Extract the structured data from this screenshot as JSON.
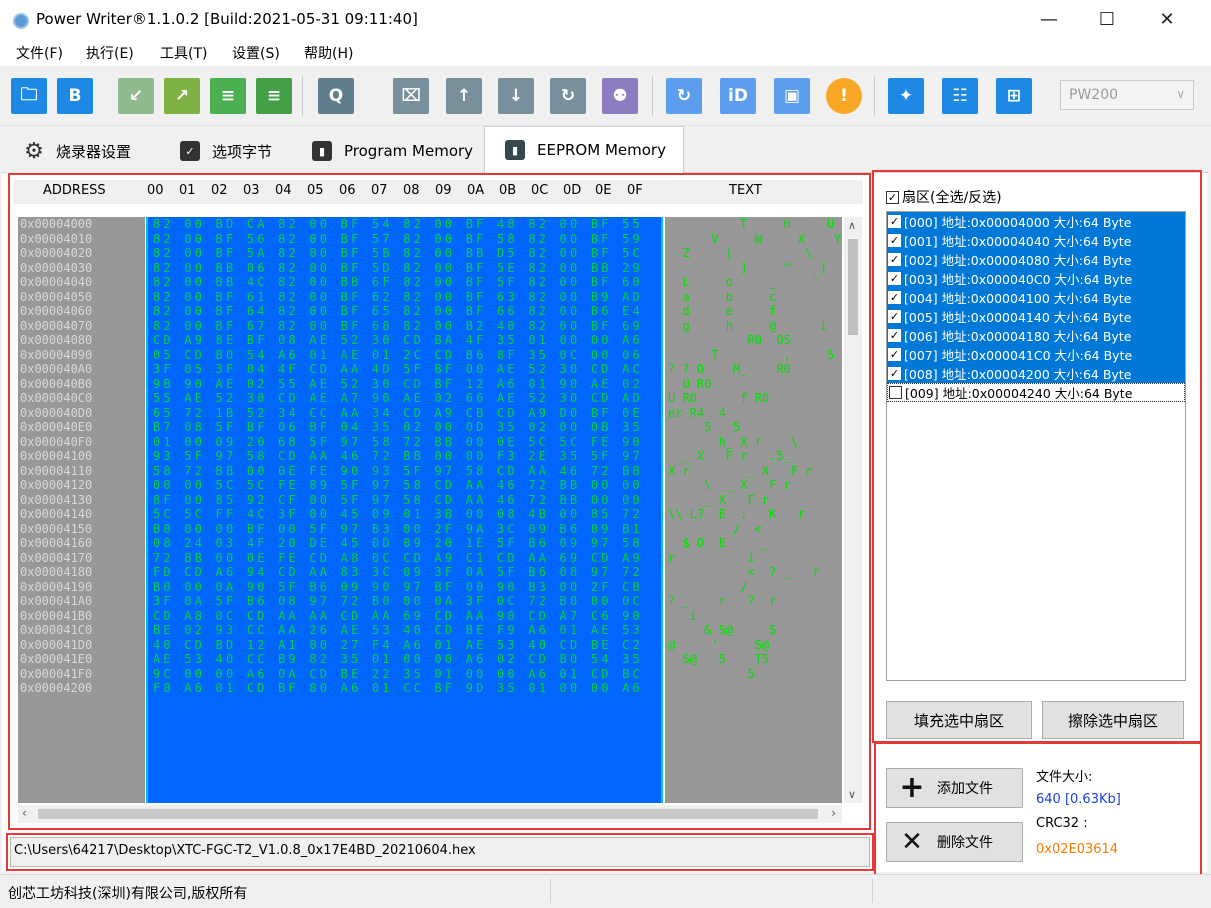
{
  "window": {
    "title": "Power Writer®1.1.0.2 [Build:2021-05-31 09:11:40]",
    "minimize_glyph": "—",
    "maximize_glyph": "☐",
    "close_glyph": "✕"
  },
  "menu": [
    "文件(F)",
    "执行(E)",
    "工具(T)",
    "设置(S)",
    "帮助(H)"
  ],
  "toolbar": {
    "buttons": [
      {
        "icon": "open-folder-icon",
        "color": "#1e88e5"
      },
      {
        "icon": "save-icon",
        "color": "#1e88e5"
      },
      {
        "icon": "import-icon",
        "color": "#8fbc8f"
      },
      {
        "icon": "export-icon",
        "color": "#7cb342"
      },
      {
        "icon": "chip-load-icon",
        "color": "#4caf50"
      },
      {
        "icon": "chip-save-icon",
        "color": "#43a047"
      },
      {
        "icon": "search-icon",
        "color": "#607d8b"
      },
      {
        "icon": "erase-chip-icon",
        "color": "#78909c"
      },
      {
        "icon": "program-chip-icon",
        "color": "#78909c"
      },
      {
        "icon": "verify-chip-icon",
        "color": "#78909c"
      },
      {
        "icon": "read-chip-icon",
        "color": "#78909c"
      },
      {
        "icon": "auto-program-icon",
        "color": "#8e7cc3"
      },
      {
        "icon": "refresh-icon",
        "color": "#5c9ded"
      },
      {
        "icon": "id-icon",
        "color": "#5c9ded"
      },
      {
        "icon": "stop-icon",
        "color": "#5c9ded"
      },
      {
        "icon": "warning-icon",
        "color": "#f9a825"
      },
      {
        "icon": "tool-icon",
        "color": "#1e88e5"
      },
      {
        "icon": "config-icon",
        "color": "#1e88e5"
      },
      {
        "icon": "layout-icon",
        "color": "#1e88e5"
      }
    ],
    "device_select": "PW200"
  },
  "tabs": [
    {
      "label": "烧录器设置",
      "icon": "gear-icon"
    },
    {
      "label": "选项字节",
      "icon": "option-icon"
    },
    {
      "label": "Program Memory",
      "icon": "memory-icon"
    },
    {
      "label": "EEPROM Memory",
      "icon": "memory-icon"
    }
  ],
  "hex": {
    "col_address": "ADDRESS",
    "columns": [
      "00",
      "01",
      "02",
      "03",
      "04",
      "05",
      "06",
      "07",
      "08",
      "09",
      "0A",
      "0B",
      "0C",
      "0D",
      "0E",
      "0F"
    ],
    "col_text": "TEXT",
    "addresses": [
      "0x00004000",
      "0x00004010",
      "0x00004020",
      "0x00004030",
      "0x00004040",
      "0x00004050",
      "0x00004060",
      "0x00004070",
      "0x00004080",
      "0x00004090",
      "0x000040A0",
      "0x000040B0",
      "0x000040C0",
      "0x000040D0",
      "0x000040E0",
      "0x000040F0",
      "0x00004100",
      "0x00004110",
      "0x00004120",
      "0x00004130",
      "0x00004140",
      "0x00004150",
      "0x00004160",
      "0x00004170",
      "0x00004180",
      "0x00004190",
      "0x000041A0",
      "0x000041B0",
      "0x000041C0",
      "0x000041D0",
      "0x000041E0",
      "0x000041F0",
      "0x00004200"
    ],
    "rows": [
      "82 00 BD CA 82 00 BF 54 82 00 BF 48 82 00 BF 55",
      "82 00 BF 56 82 00 BF 57 82 00 BF 58 82 00 BF 59",
      "82 00 BF 5A 82 00 BF 5B 82 00 BB D5 82 00 BF 5C",
      "82 00 BB 06 82 00 BF 5D 82 00 BF 5E 82 00 BB 29",
      "82 00 BB 4C 82 00 BB 6F 82 00 BF 5F 82 00 BF 60",
      "82 00 BF 61 82 00 BF 62 82 00 BF 63 82 00 B9 AD",
      "82 00 BF 64 82 00 BF 65 82 00 BF 66 82 00 B6 E4",
      "82 00 BF 67 82 00 BF 68 82 00 B2 40 82 00 BF 69",
      "CD A9 8E BF 08 AE 52 30 CD BA 4F 35 01 00 00 A6",
      "05 CD B0 54 A6 01 AE 01 2C CD B6 8F 35 0C 00 06",
      "3F 05 3F 04 4F CD AA 4D 5F BF 00 AE 52 30 CD AC",
      "9B 90 AE 02 55 AE 52 30 CD BF 12 A6 01 90 AE 02",
      "55 AE 52 30 CD AE A7 90 AE 02 66 AE 52 30 CD AD",
      "65 72 1B 52 34 CC AA 34 CD A9 CB CD A9 D0 BF 0E",
      "B7 08 5F BF 06 BF 04 35 02 00 0D 35 02 00 0B 35",
      "01 00 09 20 68 5F 97 58 72 BB 00 0E 5C 5C FE 90",
      "93 5F 97 58 CD AA 46 72 BB 00 00 F3 2E 35 5F 97",
      "58 72 BB 00 0E FE 90 93 5F 97 58 CD AA 46 72 BB",
      "00 00 5C 5C FE 89 5F 97 58 CD AA 46 72 BB 00 00",
      "8F 00 85 92 CF 00 5F 97 58 CD AA 46 72 BB 00 00",
      "5C 5C FF 4C 3F 00 45 09 01 3B 00 08 4B 00 85 72",
      "B0 00 00 BF 00 5F 97 B3 00 2F 9A 3C 09 B6 09 B1",
      "08 24 03 4F 20 DE 45 0D 09 20 1E 5F B6 09 97 58",
      "72 BB 00 0E FE CD A8 0C CD A9 C1 CD AA 69 CD A9",
      "FD CD A6 94 CD AA 83 3C 09 3F 0A 5F B6 08 97 72",
      "B0 00 0A 90 5F B6 09 90 97 BF 00 90 B3 00 2F CB",
      "3F 0A 5F B6 08 97 72 B0 00 0A 3F 0C 72 B0 00 0C",
      "CD A8 0C CD AA AA CD AA 69 CD AA 90 CD A7 C6 90",
      "BE 02 93 CC AA 26 AE 53 40 CD BE F9 A6 01 AE 53",
      "40 CD BD 12 A1 00 27 F4 A6 01 AE 53 40 CD BE C2",
      "AE 53 40 CC B9 82 35 01 00 00 A6 02 CD B0 54 35",
      "9C 00 00 A6 0A CD BE 22 35 01 00 00 A6 01 CD BC",
      "F8 A6 01 CD BF 80 A6 01 CC BF 9D 35 01 00 00 A6"
    ],
    "text_rows": [
      "          T     H     U",
      "      V     W     X    Y",
      "  Z     [          \\",
      "          ]     ^    )",
      "  L     o     _     `",
      "  a     b     c",
      "  d     e     f",
      "  g     h     @      i",
      "           R0  O5",
      "      T         ,     5",
      "? ? O    M_    R0",
      "  U R0     ",
      "U R0      f R0",
      "er R4  4",
      "     5   5",
      "       h_ X r    \\",
      "  _ X   F r   .5_",
      "X r        _ X   F r",
      "     \\  _ X   F r",
      "     _ X   F r",
      "\\\\ L?  E  ;   K   r",
      "         /  <",
      "  $ O  E     _",
      "r          i",
      "           <  ? _   r",
      "          /",
      "? _    r   ?  r",
      "   i",
      "     & S@     S",
      "@     '     S@",
      "  S@   5    T5",
      "           5"
    ]
  },
  "sector": {
    "header": "扇区(全选/反选)",
    "items": [
      {
        "label": "[000] 地址:0x00004000 大小:64 Byte",
        "checked": true
      },
      {
        "label": "[001] 地址:0x00004040 大小:64 Byte",
        "checked": true
      },
      {
        "label": "[002] 地址:0x00004080 大小:64 Byte",
        "checked": true
      },
      {
        "label": "[003] 地址:0x000040C0 大小:64 Byte",
        "checked": true
      },
      {
        "label": "[004] 地址:0x00004100 大小:64 Byte",
        "checked": true
      },
      {
        "label": "[005] 地址:0x00004140 大小:64 Byte",
        "checked": true
      },
      {
        "label": "[006] 地址:0x00004180 大小:64 Byte",
        "checked": true
      },
      {
        "label": "[007] 地址:0x000041C0 大小:64 Byte",
        "checked": true
      },
      {
        "label": "[008] 地址:0x00004200 大小:64 Byte",
        "checked": true
      },
      {
        "label": "[009] 地址:0x00004240 大小:64 Byte",
        "checked": false
      }
    ],
    "fill_button": "填充选中扇区",
    "erase_button": "擦除选中扇区"
  },
  "file": {
    "add_button": "添加文件",
    "delete_button": "删除文件",
    "size_label": "文件大小:",
    "size_value": "640 [0.63Kb]",
    "crc_label": "CRC32 :",
    "crc_value": "0x02E03614",
    "size_color": "#1a3fd8",
    "crc_color": "#f57c00",
    "path": "C:\\Users\\64217\\Desktop\\XTC-FGC-T2_V1.0.8_0x17E4BD_20210604.hex"
  },
  "status": {
    "company": "创芯工坊科技(深圳)有限公司,版权所有"
  }
}
